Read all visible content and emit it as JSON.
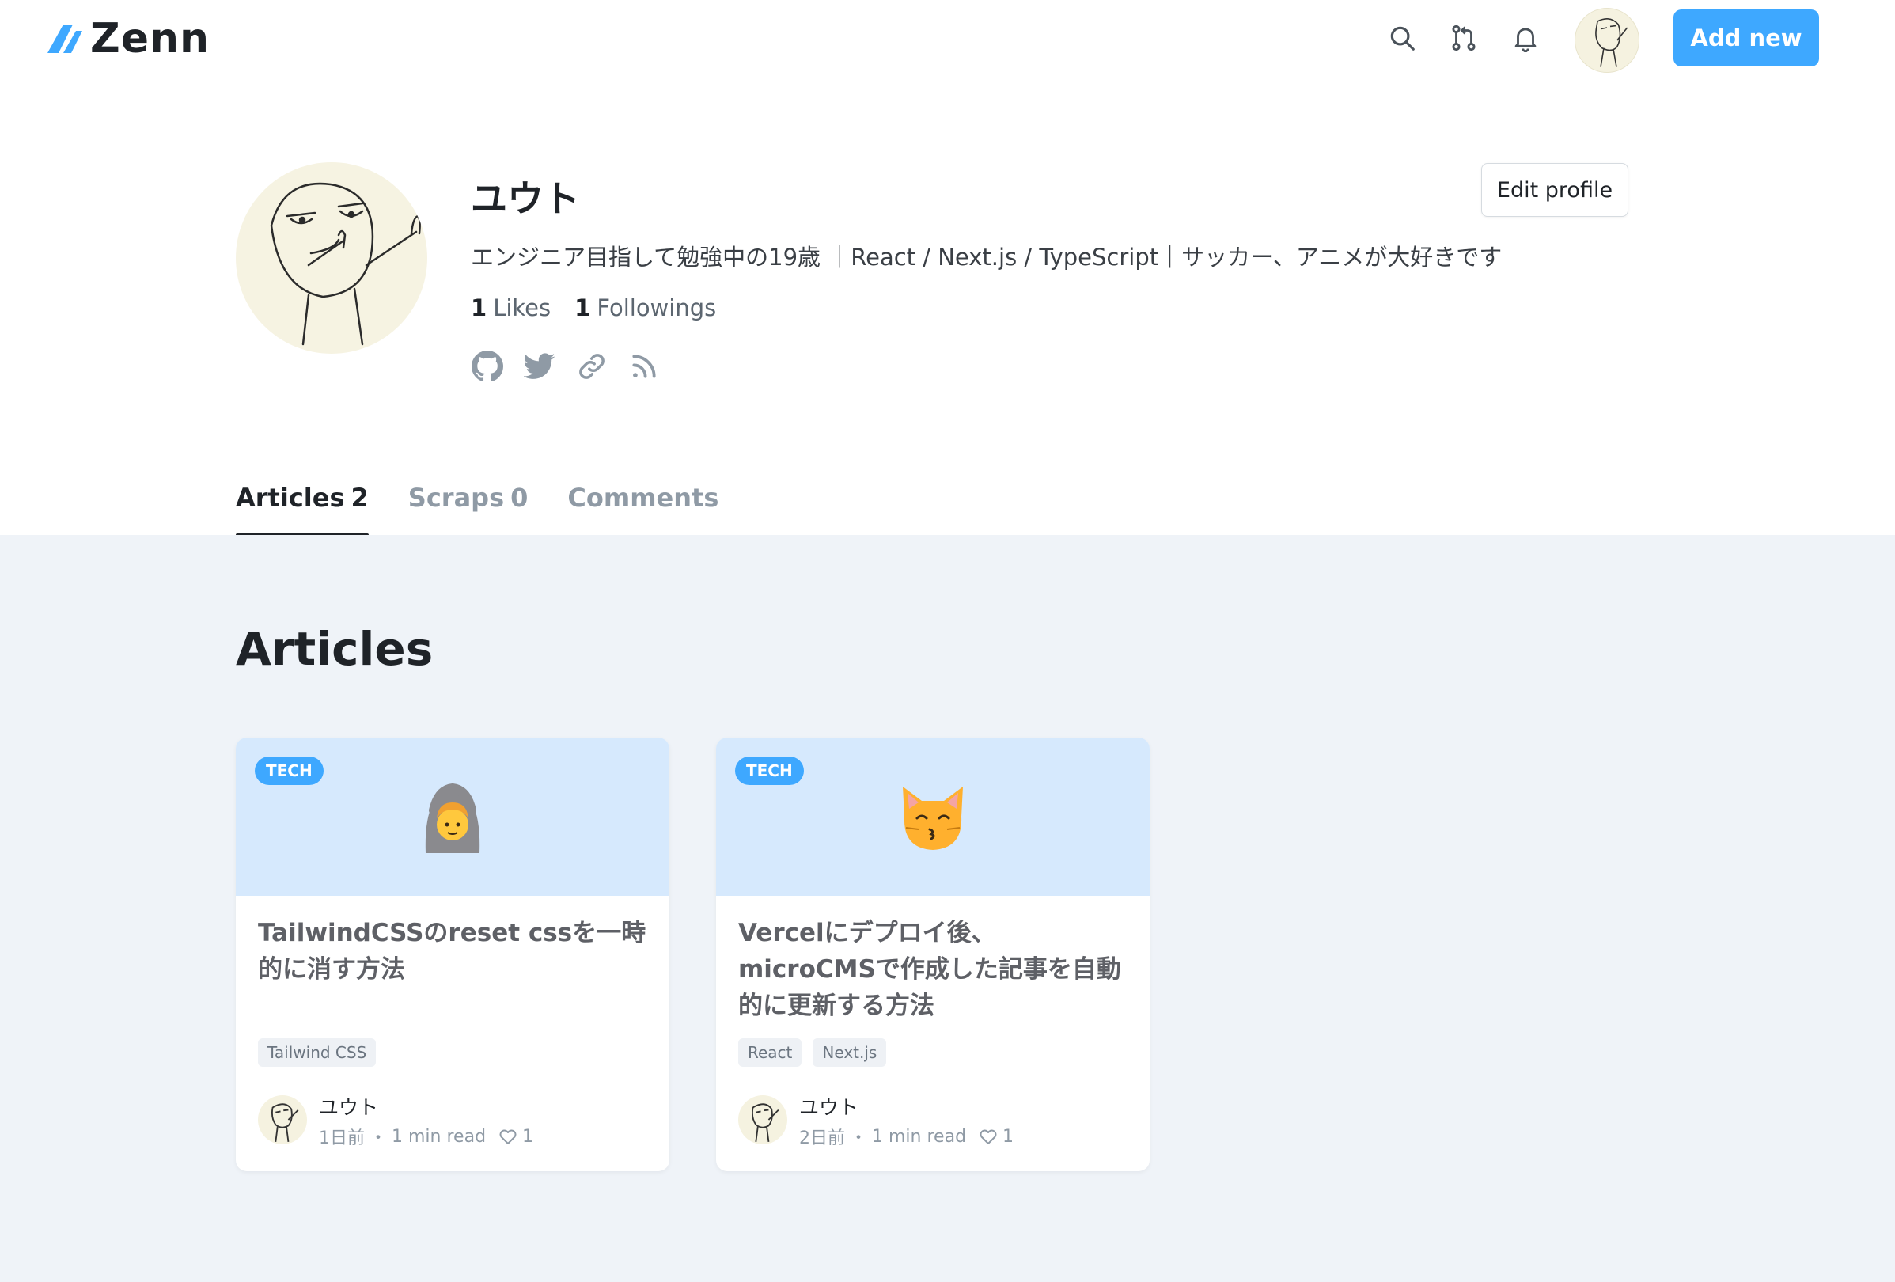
{
  "header": {
    "logo_text": "Zenn",
    "add_button": "Add new",
    "icons": [
      "search-icon",
      "pull-request-icon",
      "bell-icon"
    ],
    "accent": "#3ea8ff"
  },
  "profile": {
    "name": "ユウト",
    "edit_button": "Edit profile",
    "bio": "エンジニア目指して勉強中の19歳 ｜React / Next.js / TypeScript｜サッカー、アニメが大好きです",
    "likes_count": "1",
    "likes_label": "Likes",
    "followings_count": "1",
    "followings_label": "Followings",
    "social_icons": [
      "github-icon",
      "twitter-icon",
      "link-icon",
      "rss-icon"
    ]
  },
  "tabs": [
    {
      "label": "Articles",
      "count": "2",
      "active": true
    },
    {
      "label": "Scraps",
      "count": "0",
      "active": false
    },
    {
      "label": "Comments",
      "count": "",
      "active": false
    }
  ],
  "main": {
    "section_title": "Articles",
    "articles": [
      {
        "badge": "TECH",
        "emoji": "🙆",
        "title": "TailwindCSSのreset cssを一時的に消す方法",
        "tags": [
          "Tailwind CSS"
        ],
        "author": "ユウト",
        "date": "1日前",
        "read_time": "1 min read",
        "likes": "1"
      },
      {
        "badge": "TECH",
        "emoji": "😽",
        "title": "Vercelにデプロイ後、microCMSで作成した記事を自動的に更新する方法",
        "tags": [
          "React",
          "Next.js"
        ],
        "author": "ユウト",
        "date": "2日前",
        "read_time": "1 min read",
        "likes": "1"
      }
    ]
  }
}
